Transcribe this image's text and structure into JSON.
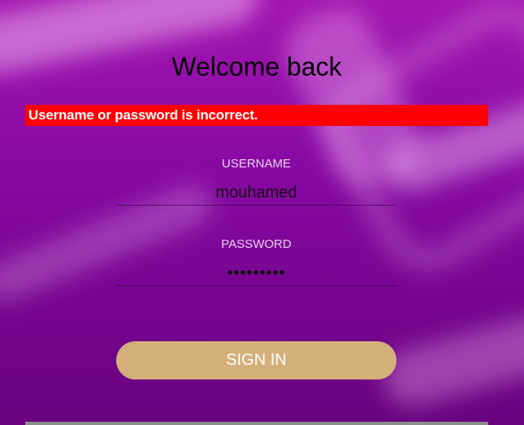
{
  "header": {
    "title": "Welcome back"
  },
  "alert": {
    "message": "Username or password is incorrect.",
    "color": "#ff0000"
  },
  "form": {
    "username": {
      "label": "USERNAME",
      "value": "mouhamed"
    },
    "password": {
      "label": "PASSWORD",
      "value": "•••••••••"
    },
    "submit_label": "SIGN IN"
  },
  "colors": {
    "background": "#8a0aa6",
    "button": "#d3b07a",
    "error": "#ff0000"
  }
}
